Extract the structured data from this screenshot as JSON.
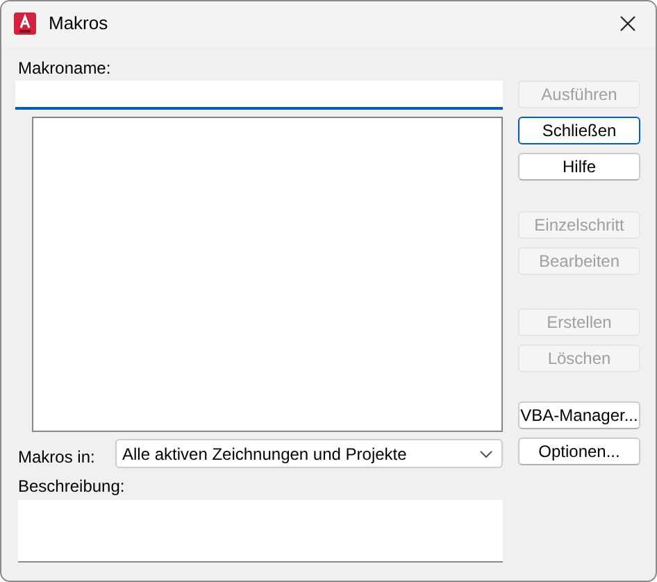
{
  "window": {
    "title": "Makros"
  },
  "macro_name": {
    "label": "Makroname:"
  },
  "buttons_top": [
    {
      "label": "Ausführen",
      "disabled": true
    },
    {
      "label": "Schließen",
      "disabled": false,
      "default": true
    },
    {
      "label": "Hilfe",
      "disabled": false
    }
  ],
  "buttons_middle": [
    {
      "label": "Einzelschritt",
      "disabled": true
    },
    {
      "label": "Bearbeiten",
      "disabled": true
    }
  ],
  "buttons_lower": [
    {
      "label": "Erstellen",
      "disabled": true
    },
    {
      "label": "Löschen",
      "disabled": true
    }
  ],
  "buttons_bottom": [
    {
      "label": "VBA-Manager...",
      "disabled": false
    },
    {
      "label": "Optionen...",
      "disabled": false
    }
  ],
  "macros_in": {
    "label": "Makros in:",
    "value": "Alle aktiven Zeichnungen und Projekte"
  },
  "description": {
    "label": "Beschreibung:"
  }
}
